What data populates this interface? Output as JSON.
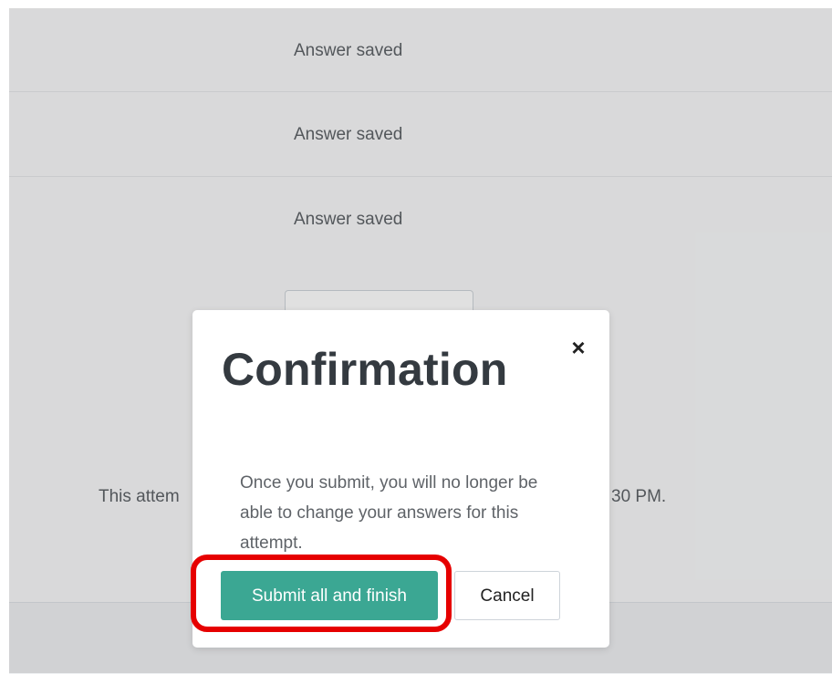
{
  "rows": [
    {
      "status": "Answer saved"
    },
    {
      "status": "Answer saved"
    },
    {
      "status": "Answer saved"
    }
  ],
  "background": {
    "partial_button_label": "",
    "summary_left": "This attem",
    "summary_right": "30 PM."
  },
  "modal": {
    "title": "Confirmation",
    "close_glyph": "×",
    "body": "Once you submit, you will no longer be able to change your answers for this attempt.",
    "submit_label": "Submit all and finish",
    "cancel_label": "Cancel"
  },
  "colors": {
    "accent": "#3ba793",
    "highlight": "#e60000"
  },
  "icons": {
    "close": "close-icon"
  }
}
